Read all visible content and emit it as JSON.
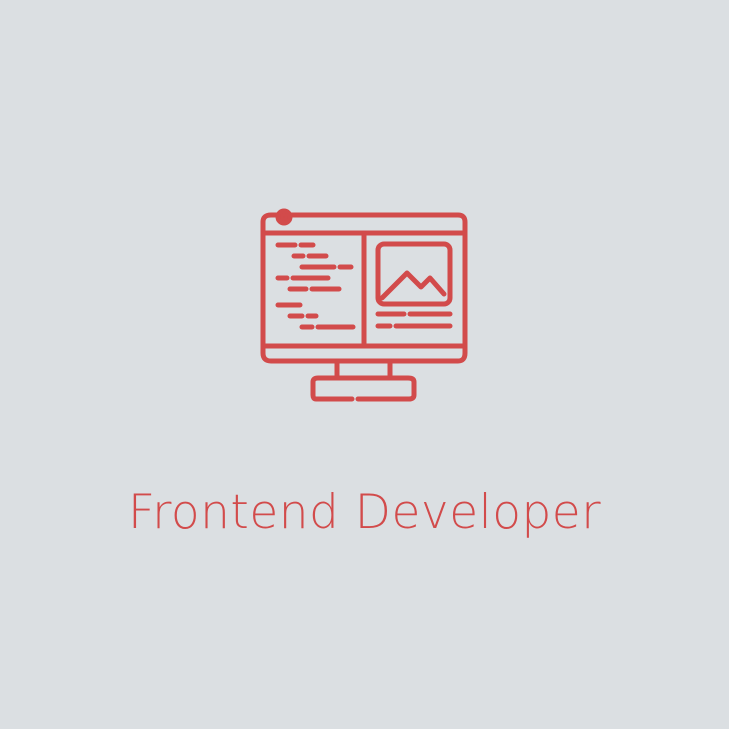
{
  "card": {
    "title": "Frontend Developer",
    "icon": "monitor-code-image-icon",
    "accent_color": "#d24b4b",
    "background_color": "#dbdfe2"
  }
}
